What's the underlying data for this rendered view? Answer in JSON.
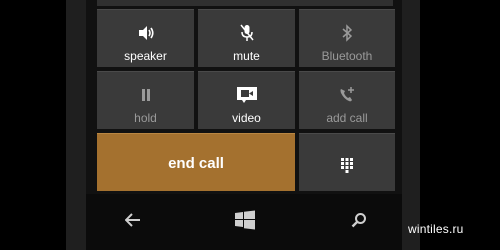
{
  "call_controls": {
    "speaker": {
      "label": "speaker",
      "icon": "speaker-icon",
      "enabled": true
    },
    "mute": {
      "label": "mute",
      "icon": "microphone-muted-icon",
      "enabled": true
    },
    "bluetooth": {
      "label": "Bluetooth",
      "icon": "bluetooth-icon",
      "enabled": false
    },
    "hold": {
      "label": "hold",
      "icon": "pause-icon",
      "enabled": false
    },
    "video": {
      "label": "video",
      "icon": "video-camera-icon",
      "enabled": true
    },
    "add_call": {
      "label": "add call",
      "icon": "add-call-icon",
      "enabled": false
    },
    "end_call": {
      "label": "end call"
    },
    "keypad": {
      "icon": "keypad-icon"
    }
  },
  "navbar": {
    "back": {
      "icon": "back-arrow-icon"
    },
    "start": {
      "icon": "windows-logo-icon"
    },
    "search": {
      "icon": "search-icon"
    }
  },
  "watermark": {
    "text": "wintiles.ru"
  },
  "colors": {
    "tile": "#3a3a3a",
    "end_call": "#a4712f",
    "background": "#000000"
  }
}
